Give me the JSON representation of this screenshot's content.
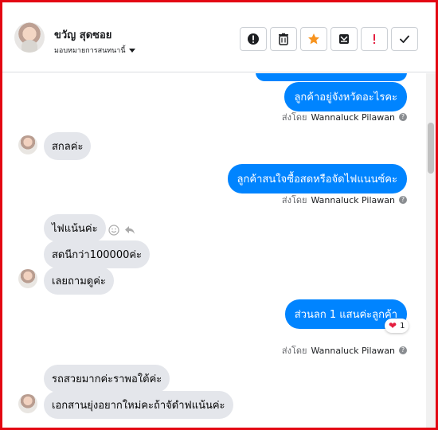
{
  "header": {
    "contact_name": "ขวัญ สุดซอย",
    "assign_label": "มอบหมายการสนทนานี้",
    "toolbar": [
      {
        "name": "alert-icon",
        "color": "#1c1e21"
      },
      {
        "name": "trash-icon",
        "color": "#1c1e21"
      },
      {
        "name": "star-icon",
        "color": "#f7931e"
      },
      {
        "name": "archive-icon",
        "color": "#1c1e21"
      },
      {
        "name": "exclamation-icon",
        "color": "#e41e3f"
      },
      {
        "name": "check-icon",
        "color": "#1c1e21"
      }
    ]
  },
  "messages": [
    {
      "type": "out",
      "text": "ลูกค้าอยู่จังหวัดอะไรคะ"
    },
    {
      "type": "sentby",
      "prefix": "ส่งโดย",
      "agent": "Wannaluck Pilawan"
    },
    {
      "type": "in",
      "text": "สกลค่ะ"
    },
    {
      "type": "out",
      "text": "ลูกค้าสนใจซื้อสดหรือจัดไฟแนนซ์คะ"
    },
    {
      "type": "sentby",
      "prefix": "ส่งโดย",
      "agent": "Wannaluck Pilawan"
    },
    {
      "type": "in",
      "text": "ไฟแน้นค่ะ"
    },
    {
      "type": "in",
      "text": "สดนีกว่า100000ค่ะ"
    },
    {
      "type": "in",
      "text": "เลยถามดูค่ะ"
    },
    {
      "type": "out",
      "text": "ส่วนลก 1 แสนค่ะลูกค้า",
      "reaction": {
        "emoji": "❤",
        "count": "1"
      }
    },
    {
      "type": "sentby",
      "prefix": "ส่งโดย",
      "agent": "Wannaluck Pilawan"
    },
    {
      "type": "in",
      "text": "รถสวยมากค่ะราพอใต้ค่ะ"
    },
    {
      "type": "in",
      "text": "เอกสานยุ่งอยากใหม่คะถ้าจัดำฟแน้นค่ะ"
    }
  ],
  "colors": {
    "accent": "#0084ff",
    "frame": "#e30613",
    "incoming": "#e4e6eb"
  }
}
